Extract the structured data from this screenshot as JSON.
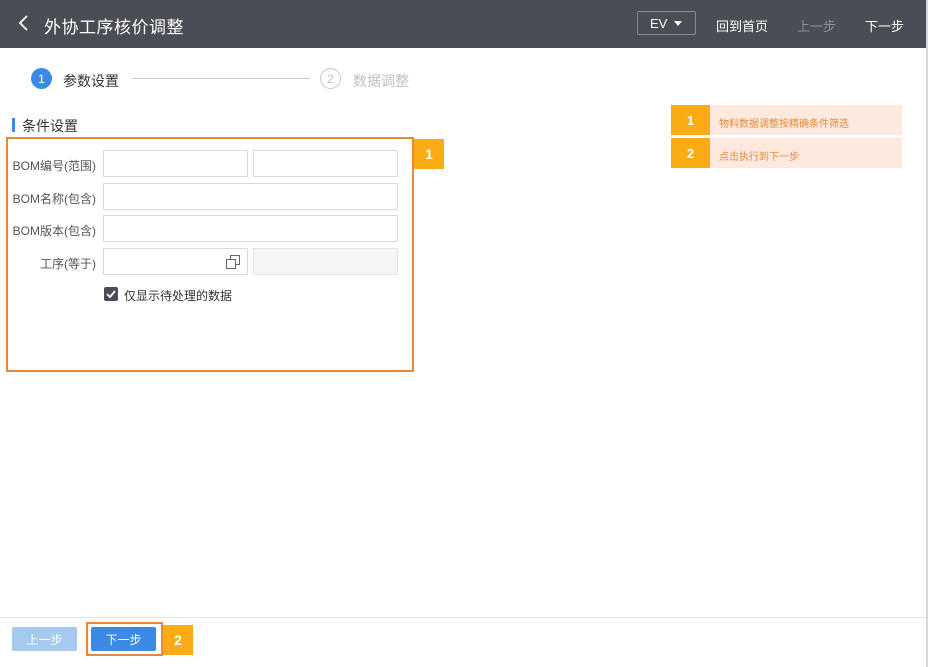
{
  "header": {
    "title": "外协工序核价调整",
    "ev_select": "EV",
    "home_link": "回到首页",
    "prev_link": "上一步",
    "next_link": "下一步"
  },
  "steps": [
    {
      "number": "1",
      "label": "参数设置"
    },
    {
      "number": "2",
      "label": "数据调整"
    }
  ],
  "section": {
    "title": "条件设置"
  },
  "form": {
    "bom_code_label": "BOM编号(范围)",
    "bom_code_from": "",
    "bom_code_to": "",
    "bom_name_label": "BOM名称(包含)",
    "bom_name_value": "",
    "bom_version_label": "BOM版本(包含)",
    "bom_version_value": "",
    "process_label": "工序(等于)",
    "process_value": "",
    "process_name_value": "",
    "only_pending_label": "仅显示待处理的数据",
    "only_pending_checked": true
  },
  "annotations": {
    "badge1": "1",
    "badge2": "2",
    "legend": [
      {
        "num": "1",
        "text": "物料数据调整按精确条件筛选"
      },
      {
        "num": "2",
        "text": "点击执行到下一步"
      }
    ]
  },
  "footer": {
    "prev_button": "上一步",
    "next_button": "下一步"
  },
  "colors": {
    "header_bg": "#4a4e54",
    "accent_blue": "#3b8ae6",
    "annotation_orange": "#e8893a",
    "badge_yellow": "#fbac15"
  }
}
